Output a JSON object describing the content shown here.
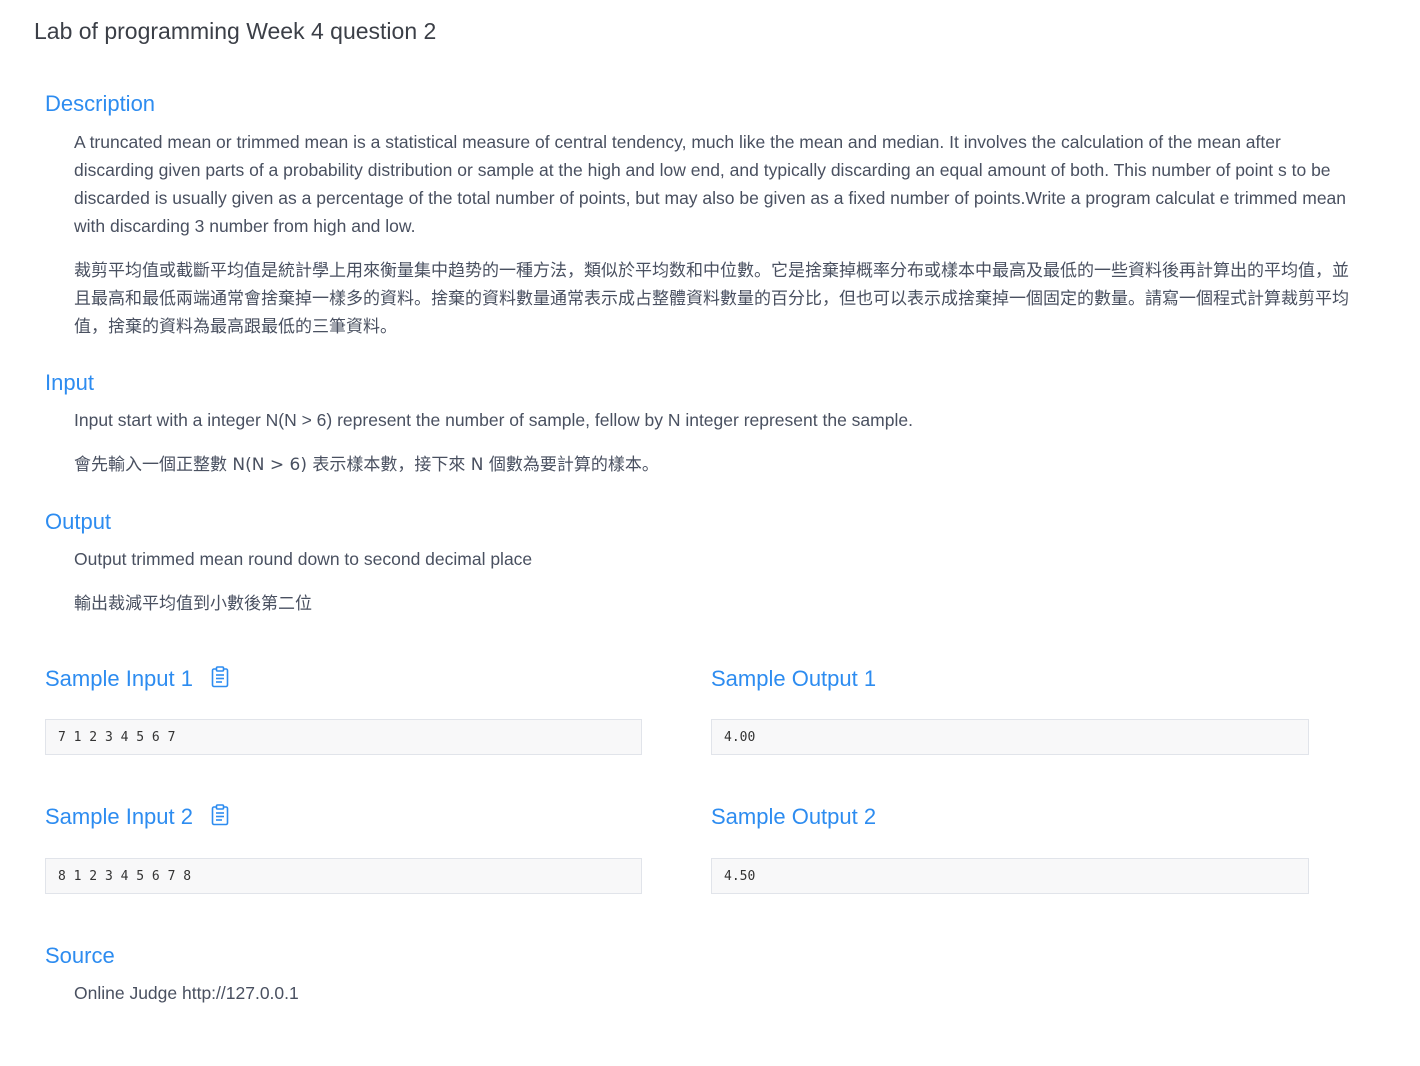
{
  "page": {
    "title": "Lab of programming Week 4 question 2"
  },
  "description": {
    "heading": "Description",
    "en": "A truncated mean or trimmed mean is a statistical measure of central tendency, much like the mean and median. It involves the calculation of the mean after discarding given parts of a probability distribution or sample at the high and low end, and typically discarding an equal amount of both. This number of point s to be discarded is usually given as a percentage of the total number of points, but may also be given as a fixed number of points.Write a program calculat e trimmed mean with discarding 3 number from high and low.",
    "zh": "裁剪平均值或截斷平均值是統計學上用來衡量集中趋势的一種方法，類似於平均数和中位數。它是捨棄掉概率分布或樣本中最高及最低的一些資料後再計算出的平均值，並且最高和最低兩端通常會捨棄掉一樣多的資料。捨棄的資料數量通常表示成占整體資料數量的百分比，但也可以表示成捨棄掉一個固定的數量。請寫一個程式計算裁剪平均值，捨棄的資料為最高跟最低的三筆資料。"
  },
  "input": {
    "heading": "Input",
    "en": "Input start with a integer N(N > 6) represent the number of sample, fellow by N integer represent the sample.",
    "zh": "會先輸入一個正整數 N(N > 6) 表示樣本數，接下來 N 個數為要計算的樣本。"
  },
  "output": {
    "heading": "Output",
    "en": "Output trimmed mean round down to second decimal place",
    "zh": "輸出裁減平均值到小數後第二位"
  },
  "samples": [
    {
      "input_label": "Sample Input 1",
      "output_label": "Sample Output 1",
      "input_value": "7 1 2 3 4 5 6 7",
      "output_value": "4.00"
    },
    {
      "input_label": "Sample Input 2",
      "output_label": "Sample Output 2",
      "input_value": "8 1 2 3 4 5 6 7 8",
      "output_value": "4.50"
    }
  ],
  "source": {
    "heading": "Source",
    "text": "Online Judge http://127.0.0.1"
  },
  "colors": {
    "accent": "#2d8cf0",
    "text": "#495060",
    "box_bg": "#f8f8f9",
    "box_border": "#e1e4ea"
  },
  "icons": {
    "copy": "clipboard-icon"
  }
}
